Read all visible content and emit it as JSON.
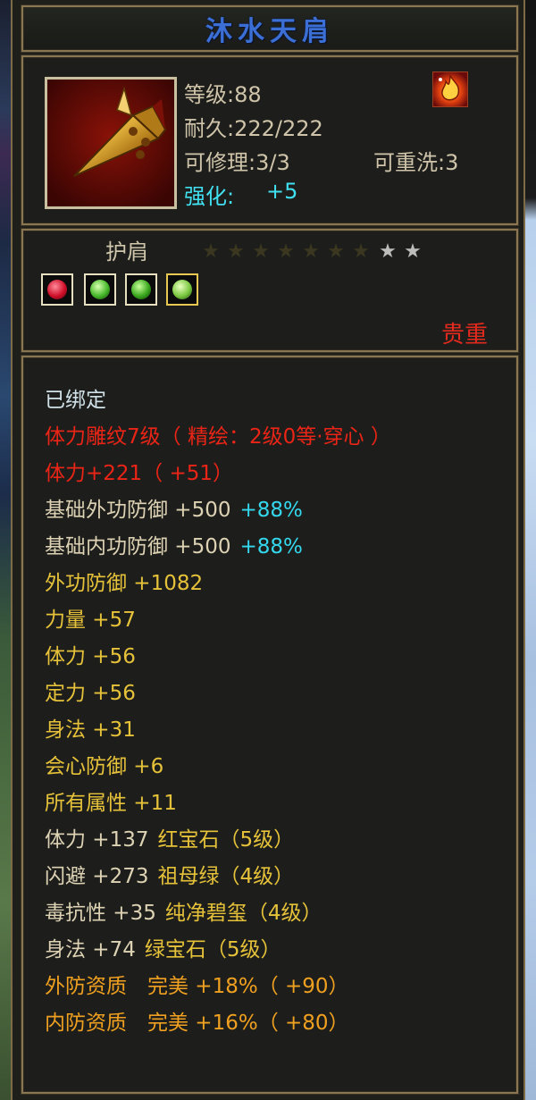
{
  "item": {
    "name": "沐水天肩",
    "level": "等级:88",
    "durability": "耐久:222/222",
    "repair": "可修理:3/3",
    "rewash": "可重洗:3",
    "enhance_label": "强化:",
    "enhance_value": "+5",
    "icon": "golden-shoulder-armor-icon",
    "buff_icon": "fire-buff-icon",
    "type": "护肩",
    "stars_filled": 7,
    "stars_total": 9,
    "gems": [
      "red-gem-icon",
      "green-gem-icon",
      "green-gem-icon",
      "green-gem-icon"
    ],
    "rarity": "贵重"
  },
  "attributes": {
    "bound": "已绑定",
    "engrave": "体力雕纹7级（ 精绘：2级0等·穿心 ）",
    "engrave_stat": "体力+221（ +51）",
    "base_ext_def": "基础外功防御 +500",
    "base_ext_def_pct": "+88%",
    "base_int_def": "基础内功防御 +500",
    "base_int_def_pct": "+88%",
    "ext_def": "外功防御 +1082",
    "strength": "力量 +57",
    "stamina": "体力 +56",
    "focus": "定力 +56",
    "agility": "身法 +31",
    "crit_def": "会心防御 +6",
    "all_attr": "所有属性 +11",
    "gem1_stat": "体力 +137",
    "gem1_name": "红宝石（5级）",
    "gem2_stat": "闪避 +273",
    "gem2_name": "祖母绿（4级）",
    "gem3_stat": "毒抗性 +35",
    "gem3_name": "纯净碧玺（4级）",
    "gem4_stat": "身法 +74",
    "gem4_name": "绿宝石（5级）",
    "quality1": "外防资质　完美 +18%（ +90）",
    "quality2": "内防资质　完美 +16%（ +80）"
  },
  "colors": {
    "title": "#3b6fd6",
    "frame": "#8a7650",
    "rarity": "#e42a1e",
    "star_filled": "#3a3620",
    "star_empty": "#bdbdbd"
  }
}
